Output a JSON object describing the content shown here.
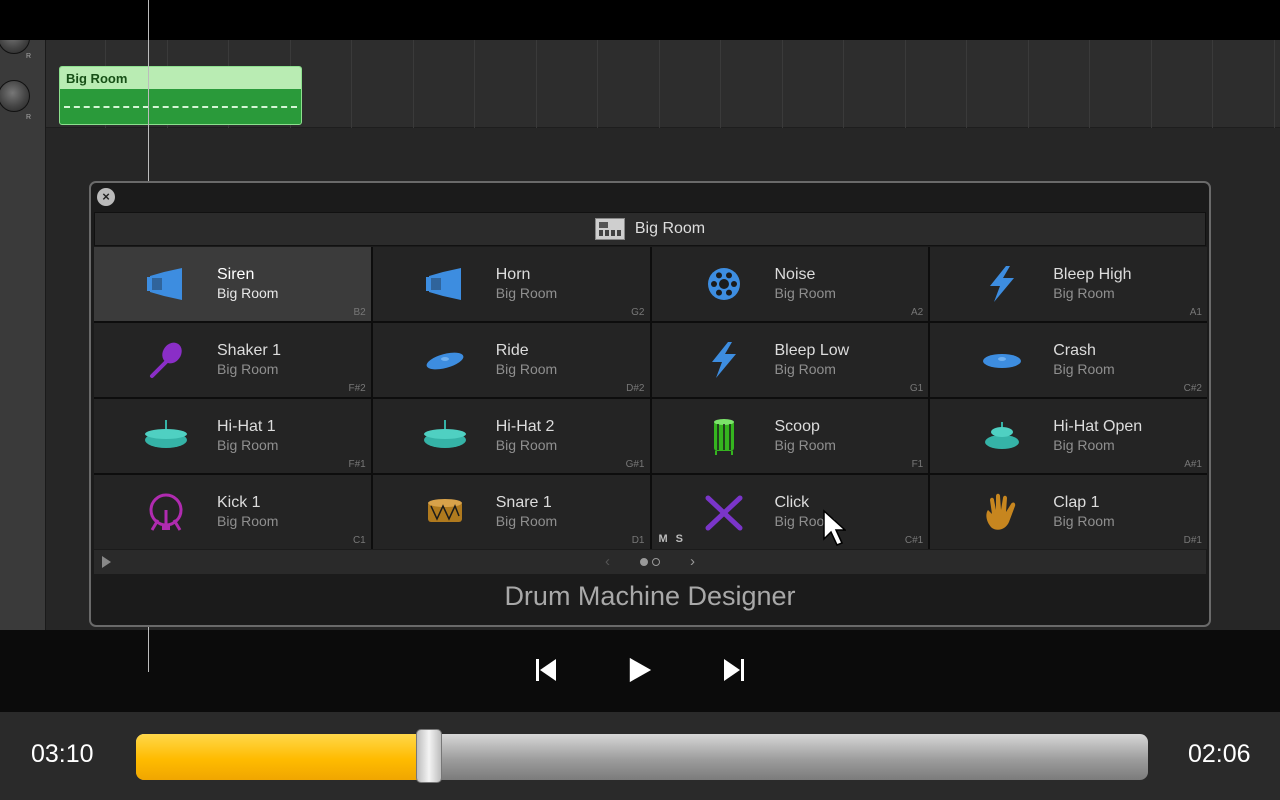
{
  "track": {
    "region_name": "Big Room"
  },
  "plugin": {
    "kit_name": "Big Room",
    "title": "Drum Machine Designer",
    "mute_label": "M",
    "solo_label": "S",
    "pager": {
      "prev": "‹",
      "next": "›",
      "pages": 2,
      "current_page": 1
    },
    "pads": [
      {
        "name": "Siren",
        "kit": "Big Room",
        "note": "B2",
        "icon": "siren-icon",
        "color": "#3d8de0",
        "selected": true
      },
      {
        "name": "Horn",
        "kit": "Big Room",
        "note": "G2",
        "icon": "horn-icon",
        "color": "#3d8de0"
      },
      {
        "name": "Noise",
        "kit": "Big Room",
        "note": "A2",
        "icon": "noise-icon",
        "color": "#3d8de0"
      },
      {
        "name": "Bleep High",
        "kit": "Big Room",
        "note": "A1",
        "icon": "lightning-icon",
        "color": "#3d8de0"
      },
      {
        "name": "Shaker 1",
        "kit": "Big Room",
        "note": "F#2",
        "icon": "shaker-icon",
        "color": "#8a2ec7"
      },
      {
        "name": "Ride",
        "kit": "Big Room",
        "note": "D#2",
        "icon": "ride-cymbal-icon",
        "color": "#3d8de0"
      },
      {
        "name": "Bleep Low",
        "kit": "Big Room",
        "note": "G1",
        "icon": "lightning-icon",
        "color": "#3d8de0"
      },
      {
        "name": "Crash",
        "kit": "Big Room",
        "note": "C#2",
        "icon": "crash-cymbal-icon",
        "color": "#3d8de0"
      },
      {
        "name": "Hi-Hat 1",
        "kit": "Big Room",
        "note": "F#1",
        "icon": "hihat-icon",
        "color": "#35b3a7"
      },
      {
        "name": "Hi-Hat 2",
        "kit": "Big Room",
        "note": "G#1",
        "icon": "hihat-icon",
        "color": "#35b3a7"
      },
      {
        "name": "Scoop",
        "kit": "Big Room",
        "note": "F1",
        "icon": "tom-drum-icon",
        "color": "#35b51f"
      },
      {
        "name": "Hi-Hat Open",
        "kit": "Big Room",
        "note": "A#1",
        "icon": "hihat-open-icon",
        "color": "#35b3a7"
      },
      {
        "name": "Kick 1",
        "kit": "Big Room",
        "note": "C1",
        "icon": "kick-drum-icon",
        "color": "#b02bb0"
      },
      {
        "name": "Snare 1",
        "kit": "Big Room",
        "note": "D1",
        "icon": "snare-drum-icon",
        "color": "#b07a1e"
      },
      {
        "name": "Click",
        "kit": "Big Room",
        "note": "C#1",
        "icon": "drumsticks-icon",
        "color": "#7a35c9",
        "show_ms": true
      },
      {
        "name": "Clap 1",
        "kit": "Big Room",
        "note": "D#1",
        "icon": "clap-hand-icon",
        "color": "#c7861f"
      }
    ]
  },
  "transport": {
    "buttons": [
      "skip-back",
      "play",
      "skip-forward"
    ]
  },
  "player": {
    "elapsed": "03:10",
    "remaining": "02:06",
    "progress": 0.29
  },
  "colors": {
    "progress_fill": "#ffbb00",
    "region_green": "#2a9a3a"
  }
}
